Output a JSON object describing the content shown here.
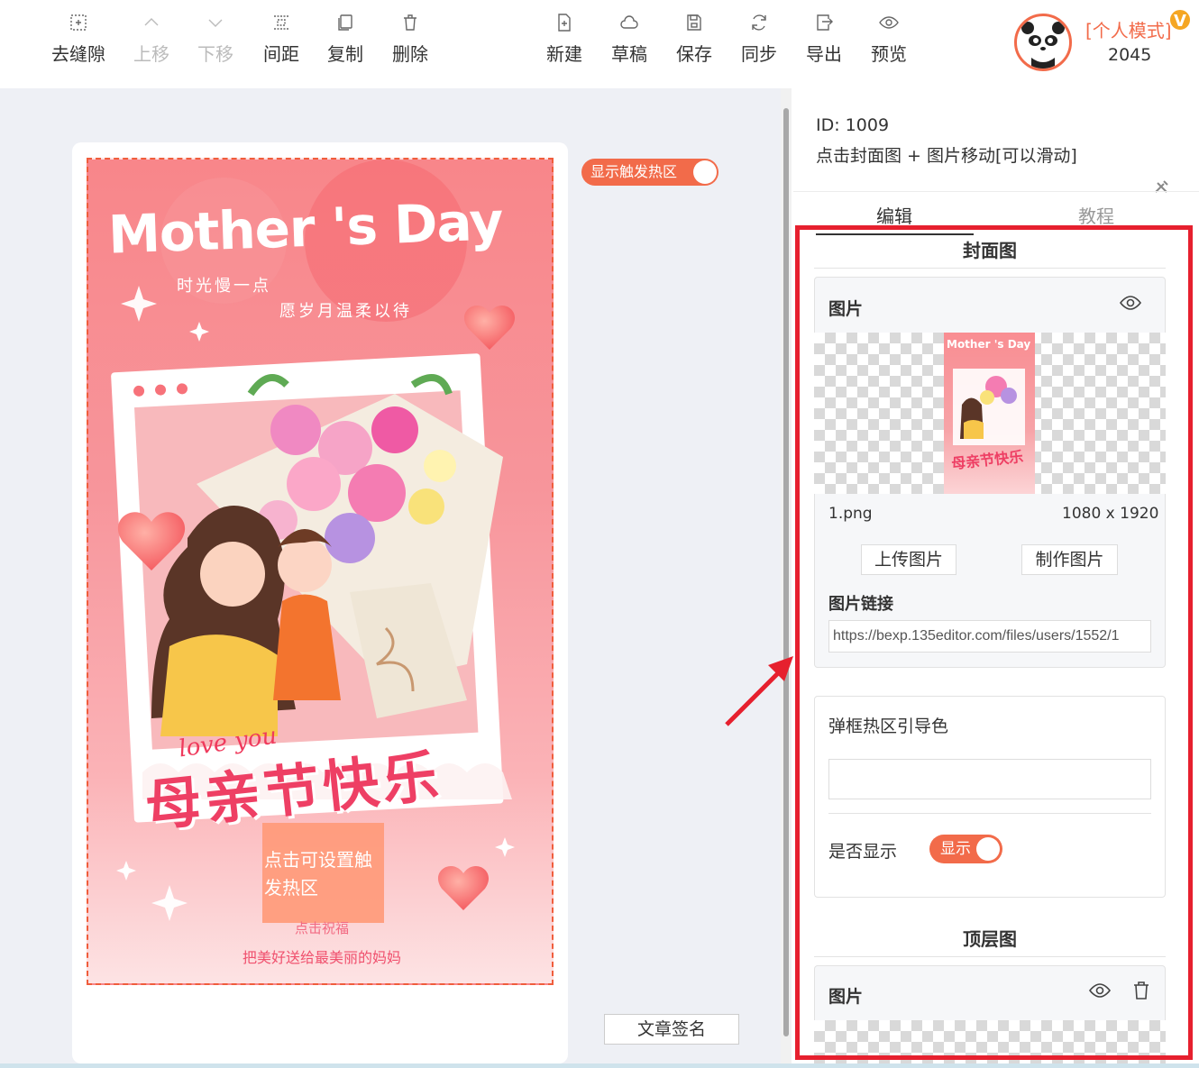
{
  "toolbar": {
    "left_buttons": [
      {
        "label": "去缝隙",
        "icon": "gap-icon",
        "disabled": false
      },
      {
        "label": "上移",
        "icon": "chevron-up-icon",
        "disabled": true
      },
      {
        "label": "下移",
        "icon": "chevron-down-icon",
        "disabled": true
      },
      {
        "label": "间距",
        "icon": "spacing-icon",
        "disabled": false
      },
      {
        "label": "复制",
        "icon": "copy-icon",
        "disabled": false
      },
      {
        "label": "删除",
        "icon": "trash-icon",
        "disabled": false
      }
    ],
    "right_buttons": [
      {
        "label": "新建",
        "icon": "new-file-icon"
      },
      {
        "label": "草稿",
        "icon": "cloud-icon"
      },
      {
        "label": "保存",
        "icon": "save-icon"
      },
      {
        "label": "同步",
        "icon": "sync-icon"
      },
      {
        "label": "导出",
        "icon": "export-icon"
      },
      {
        "label": "预览",
        "icon": "eye-icon"
      }
    ]
  },
  "user": {
    "mode_label": "[个人模式]",
    "vip_badge": "V",
    "number": "2045",
    "avatar_icon": "panda-avatar"
  },
  "canvas": {
    "trigger_toggle_label": "显示触发热区",
    "trigger_toggle_on": true,
    "signature_button": "文章签名",
    "poster": {
      "title_en": "Mother 's Day",
      "subtitle_line1": "时光慢一点",
      "subtitle_line2": "愿岁月温柔以待",
      "love_you": "love you",
      "title_cn": "母亲节快乐",
      "hotspot_label": "点击可设置触发热区",
      "cta_small": "点击祝福",
      "cta_text": "把美好送给最美丽的妈妈"
    }
  },
  "panel": {
    "id_label": "ID: 1009",
    "description": "点击封面图 + 图片移动[可以滑动]",
    "tabs": [
      {
        "label": "编辑",
        "active": true
      },
      {
        "label": "教程",
        "active": false
      }
    ],
    "cover_section": {
      "title": "封面图",
      "image_card": {
        "header": "图片",
        "thumb_title": "Mother 's Day",
        "thumb_cn": "母亲节快乐",
        "file_name": "1.png",
        "dimensions": "1080 x 1920",
        "upload_button": "上传图片",
        "make_button": "制作图片",
        "link_label": "图片链接",
        "link_value": "https://bexp.135editor.com/files/users/1552/1"
      },
      "settings_card": {
        "guide_color_label": "弹框热区引导色",
        "guide_color_value": "",
        "visible_label": "是否显示",
        "visible_toggle_label": "显示",
        "visible_on": true
      }
    },
    "top_section": {
      "title": "顶层图",
      "image_card": {
        "header": "图片"
      }
    }
  },
  "colors": {
    "accent": "#f26b4a",
    "highlight_box": "#e6202e",
    "poster_pink": "#f8868a",
    "hotspot": "#ff9a7a"
  }
}
